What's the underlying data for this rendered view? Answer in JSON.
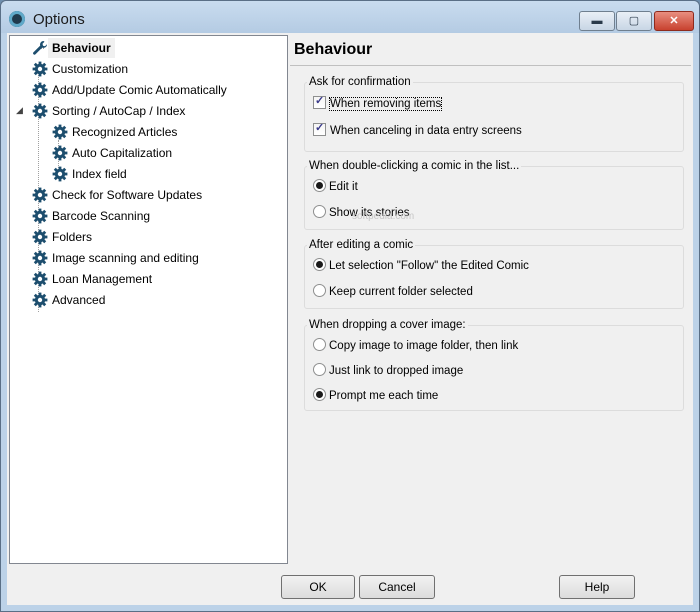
{
  "window": {
    "title": "Options",
    "controls": {
      "minimize": "▬",
      "maximize": "▢",
      "close": "✕"
    }
  },
  "tree": {
    "items": [
      {
        "label": "Behaviour",
        "icon": "wrench-icon",
        "level": 0,
        "selected": true
      },
      {
        "label": "Customization",
        "icon": "gear-icon",
        "level": 0
      },
      {
        "label": "Add/Update Comic Automatically",
        "icon": "gear-icon",
        "level": 0
      },
      {
        "label": "Sorting / AutoCap / Index",
        "icon": "gear-icon",
        "level": 0,
        "expanded": true
      },
      {
        "label": "Recognized Articles",
        "icon": "gear-icon",
        "level": 1
      },
      {
        "label": "Auto Capitalization",
        "icon": "gear-icon",
        "level": 1
      },
      {
        "label": "Index field",
        "icon": "gear-icon",
        "level": 1
      },
      {
        "label": "Check for Software Updates",
        "icon": "gear-icon",
        "level": 0
      },
      {
        "label": "Barcode Scanning",
        "icon": "gear-icon",
        "level": 0
      },
      {
        "label": "Folders",
        "icon": "gear-icon",
        "level": 0
      },
      {
        "label": "Image scanning and editing",
        "icon": "gear-icon",
        "level": 0
      },
      {
        "label": "Loan Management",
        "icon": "gear-icon",
        "level": 0
      },
      {
        "label": "Advanced",
        "icon": "gear-icon",
        "level": 0
      }
    ],
    "expander_glyph": "◢"
  },
  "content": {
    "heading": "Behaviour",
    "groups": [
      {
        "title": "Ask for confirmation",
        "options": [
          {
            "label": "When removing items",
            "type": "checkbox",
            "checked": true
          },
          {
            "label": "When canceling in data entry screens",
            "type": "checkbox",
            "checked": true
          }
        ]
      },
      {
        "title": "When double-clicking a comic in the list...",
        "options": [
          {
            "label": "Edit it",
            "type": "radio",
            "checked": true
          },
          {
            "label": "Show its stories",
            "type": "radio",
            "checked": false
          }
        ]
      },
      {
        "title": "After editing a comic",
        "options": [
          {
            "label": "Let selection \"Follow\" the Edited Comic",
            "type": "radio",
            "checked": true
          },
          {
            "label": "Keep current folder selected",
            "type": "radio",
            "checked": false
          }
        ]
      },
      {
        "title": "When dropping a cover image:",
        "options": [
          {
            "label": "Copy image to image folder, then link",
            "type": "radio",
            "checked": false
          },
          {
            "label": "Just link to dropped image",
            "type": "radio",
            "checked": false
          },
          {
            "label": "Prompt me each time",
            "type": "radio",
            "checked": true
          }
        ]
      }
    ]
  },
  "buttons": {
    "ok": "OK",
    "cancel": "Cancel",
    "help": "Help"
  },
  "watermark": "softpedia.com",
  "colors": {
    "gear": "#1d4e6e",
    "gear_hub": "#ffffff",
    "selected_bg": "#f0f0f0"
  }
}
